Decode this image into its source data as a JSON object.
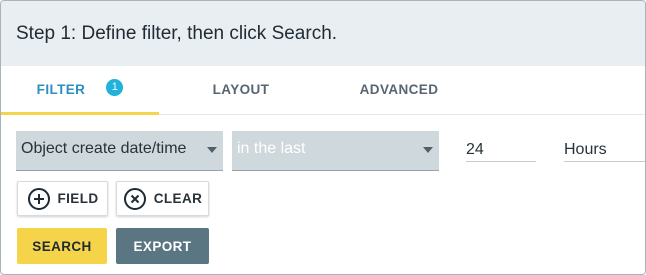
{
  "header": {
    "title": "Step 1: Define filter, then click Search."
  },
  "tabs": {
    "filter": {
      "label": "FILTER",
      "badge": "1"
    },
    "layout": {
      "label": "LAYOUT"
    },
    "advanced": {
      "label": "ADVANCED"
    }
  },
  "filter_row": {
    "field_select": {
      "value": "Object create date/time"
    },
    "operator_select": {
      "value": "in the last"
    },
    "amount": {
      "value": "24"
    },
    "unit": {
      "value": "Hours"
    }
  },
  "buttons": {
    "field": {
      "label": "FIELD",
      "icon": "plus-circle-icon"
    },
    "clear": {
      "label": "CLEAR",
      "icon": "x-circle-icon"
    },
    "search": {
      "label": "SEARCH"
    },
    "export": {
      "label": "EXPORT"
    }
  },
  "colors": {
    "accent_yellow": "#f6d44a",
    "badge_blue": "#20b2d8",
    "export_bg": "#5b7683",
    "select_bg": "#cfd8dd",
    "header_bg": "#e9eef2"
  }
}
